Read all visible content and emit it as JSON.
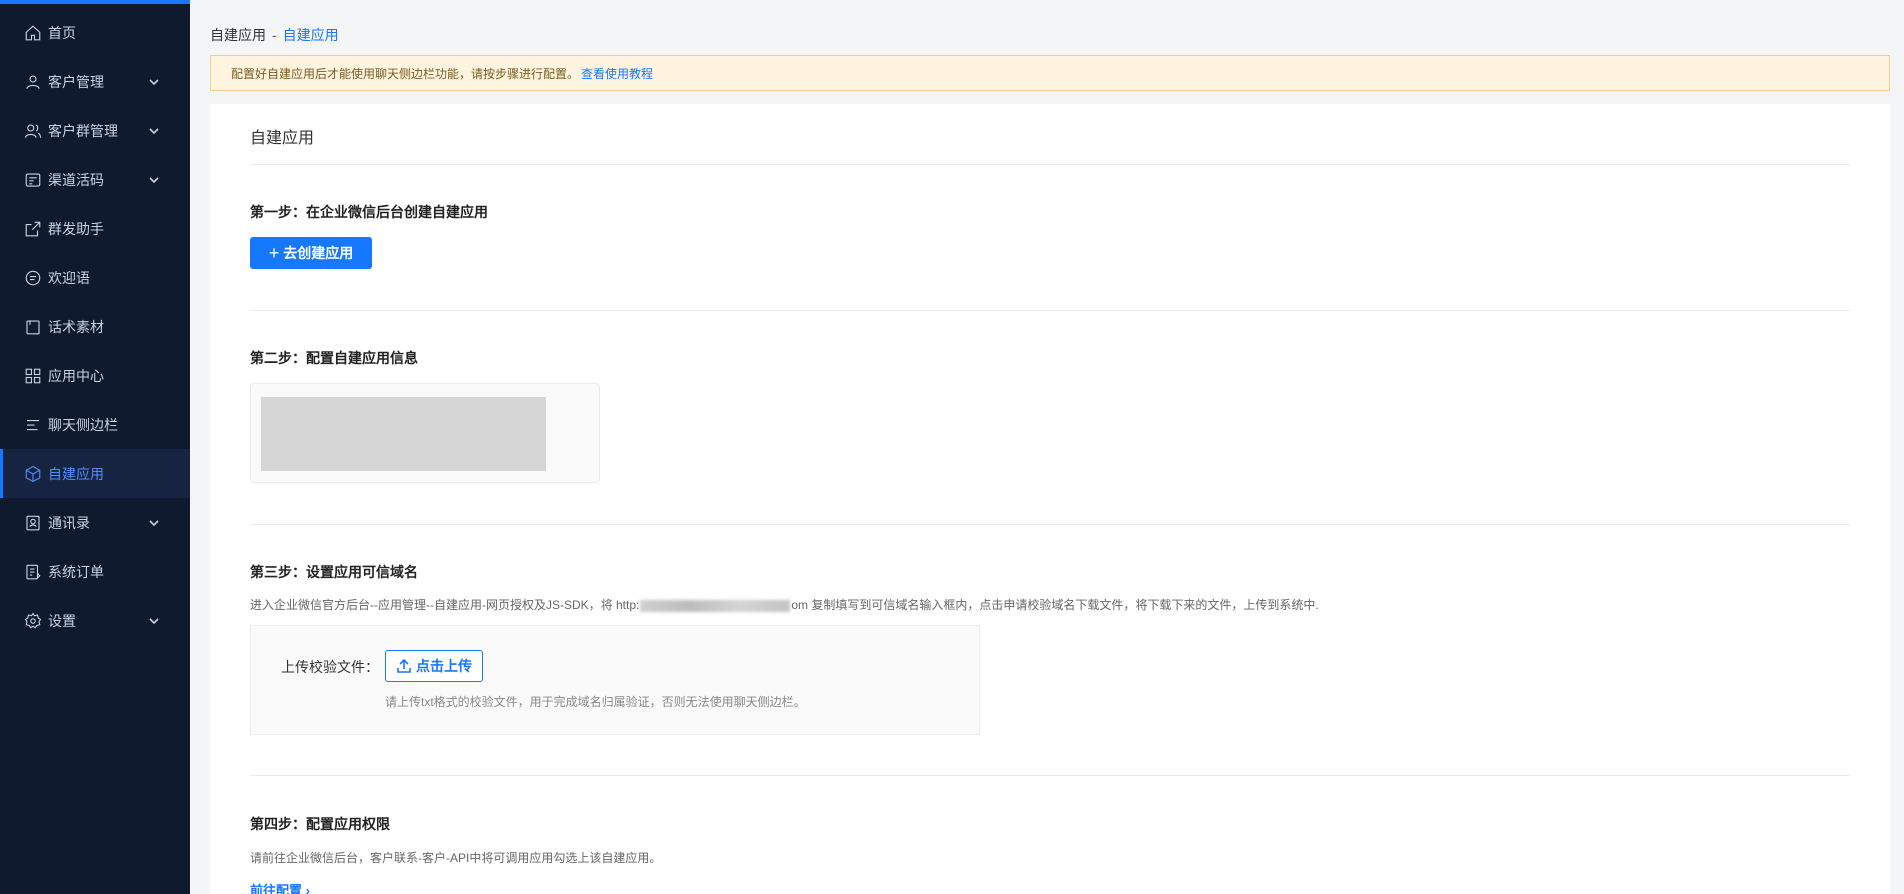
{
  "sidebar": {
    "items": [
      {
        "label": "首页",
        "icon": "home-icon",
        "has_children": false,
        "active": false
      },
      {
        "label": "客户管理",
        "icon": "user-icon",
        "has_children": true,
        "active": false
      },
      {
        "label": "客户群管理",
        "icon": "users-icon",
        "has_children": true,
        "active": false
      },
      {
        "label": "渠道活码",
        "icon": "qrcode-icon",
        "has_children": true,
        "active": false
      },
      {
        "label": "群发助手",
        "icon": "share-icon",
        "has_children": false,
        "active": false
      },
      {
        "label": "欢迎语",
        "icon": "message-icon",
        "has_children": false,
        "active": false
      },
      {
        "label": "话术素材",
        "icon": "book-icon",
        "has_children": false,
        "active": false
      },
      {
        "label": "应用中心",
        "icon": "apps-icon",
        "has_children": false,
        "active": false
      },
      {
        "label": "聊天侧边栏",
        "icon": "list-icon",
        "has_children": false,
        "active": false
      },
      {
        "label": "自建应用",
        "icon": "cube-icon",
        "has_children": false,
        "active": true
      },
      {
        "label": "通讯录",
        "icon": "contacts-icon",
        "has_children": true,
        "active": false
      },
      {
        "label": "系统订单",
        "icon": "order-icon",
        "has_children": false,
        "active": false
      },
      {
        "label": "设置",
        "icon": "gear-icon",
        "has_children": true,
        "active": false
      }
    ]
  },
  "breadcrumb": {
    "parent": "自建应用",
    "separator": "-",
    "current": "自建应用"
  },
  "notice": {
    "text": "配置好自建应用后才能使用聊天侧边栏功能，请按步骤进行配置。",
    "link": "查看使用教程"
  },
  "card": {
    "title": "自建应用"
  },
  "step1": {
    "title": "第一步：在企业微信后台创建自建应用",
    "button": "去创建应用"
  },
  "step2": {
    "title": "第二步：配置自建应用信息"
  },
  "step3": {
    "title": "第三步：设置应用可信域名",
    "desc_before": "进入企业微信官方后台--应用管理--自建应用-网页授权及JS-SDK，将 http:",
    "desc_after": "om 复制填写到可信域名输入框内，点击申请校验域名下载文件，将下载下来的文件，上传到系统中.",
    "upload_label": "上传校验文件：",
    "upload_button": "点击上传",
    "upload_hint": "请上传txt格式的校验文件，用于完成域名归属验证，否则无法使用聊天侧边栏。"
  },
  "step4": {
    "title": "第四步：配置应用权限",
    "desc": "请前往企业微信后台，客户联系-客户-API中将可调用应用勾选上该自建应用。",
    "link": "前往配置 ›"
  },
  "colors": {
    "primary": "#1677ff",
    "sidebar_bg": "#0f1a2f",
    "notice_bg": "#fff4e0"
  }
}
